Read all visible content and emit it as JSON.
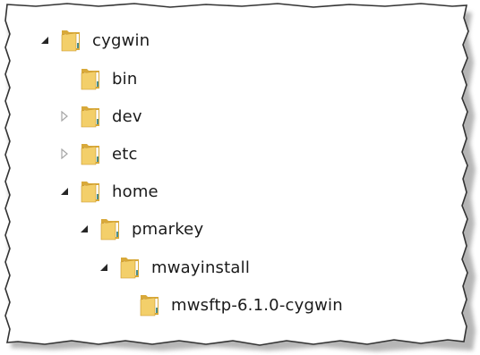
{
  "tree": {
    "nodes": [
      {
        "id": "cygwin",
        "label": "cygwin",
        "expander": "expanded"
      },
      {
        "id": "bin",
        "label": "bin",
        "expander": "none"
      },
      {
        "id": "dev",
        "label": "dev",
        "expander": "collapsed"
      },
      {
        "id": "etc",
        "label": "etc",
        "expander": "collapsed"
      },
      {
        "id": "home",
        "label": "home",
        "expander": "expanded"
      },
      {
        "id": "pmarkey",
        "label": "pmarkey",
        "expander": "expanded"
      },
      {
        "id": "mwayinstall",
        "label": "mwayinstall",
        "expander": "expanded"
      },
      {
        "id": "mwsftp",
        "label": "mwsftp-6.1.0-cygwin",
        "expander": "none"
      }
    ]
  },
  "icons": {
    "folder": "folder-icon",
    "expanded": "expanded-arrow-icon",
    "collapsed": "collapsed-arrow-icon"
  },
  "colors": {
    "folder_front": "#f3cf6a",
    "folder_back": "#d8a93a",
    "folder_paper": "#ffffff",
    "expanded_arrow": "#262626",
    "collapsed_arrow": "#a6a6a6",
    "border": "#333333"
  }
}
